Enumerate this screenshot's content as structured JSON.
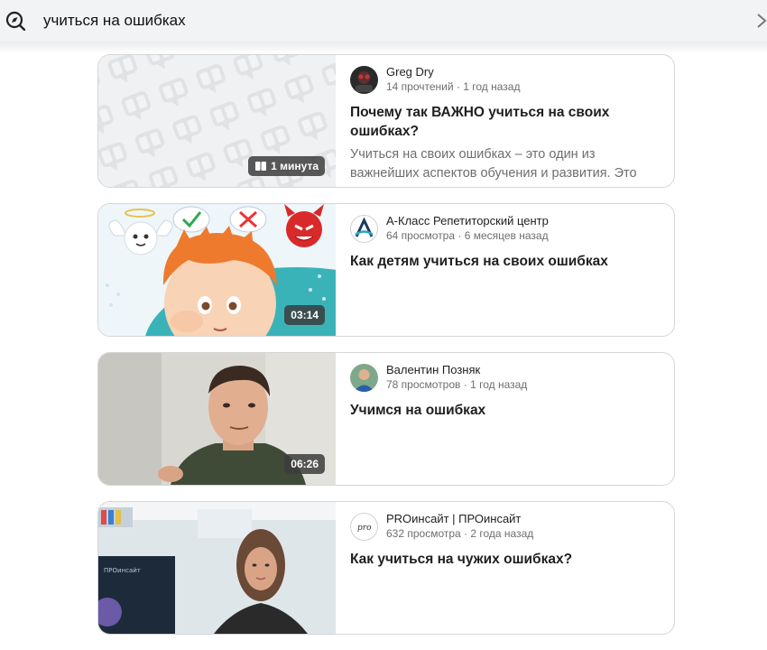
{
  "search": {
    "query": "учиться на ошибках"
  },
  "icons": {
    "search": "compass-search-icon",
    "clear": "chevron-right-icon",
    "article": "book-icon"
  },
  "results": [
    {
      "type": "article",
      "channel": "Greg Dry",
      "meta": "14 прочтений · 1 год назад",
      "title": "Почему так ВАЖНО учиться на своих ошибках?",
      "snippet": "Учиться на своих ошибках – это один из важнейших аспектов обучения и развития. Это",
      "duration": "1 минута"
    },
    {
      "type": "video",
      "channel": "А-Класс Репетиторский центр",
      "meta": "64 просмотра · 6 месяцев назад",
      "title": "Как детям учиться на своих ошибках",
      "duration": "03:14"
    },
    {
      "type": "video",
      "channel": "Валентин Позняк",
      "meta": "78 просмотров · 1 год назад",
      "title": "Учимся на ошибках",
      "duration": "06:26"
    },
    {
      "type": "video",
      "channel": "PROинсайт | ПРОинсайт",
      "meta": "632 просмотра · 2 года назад",
      "title": "Как учиться на чужих ошибках?",
      "avatar_text": "pro"
    }
  ]
}
